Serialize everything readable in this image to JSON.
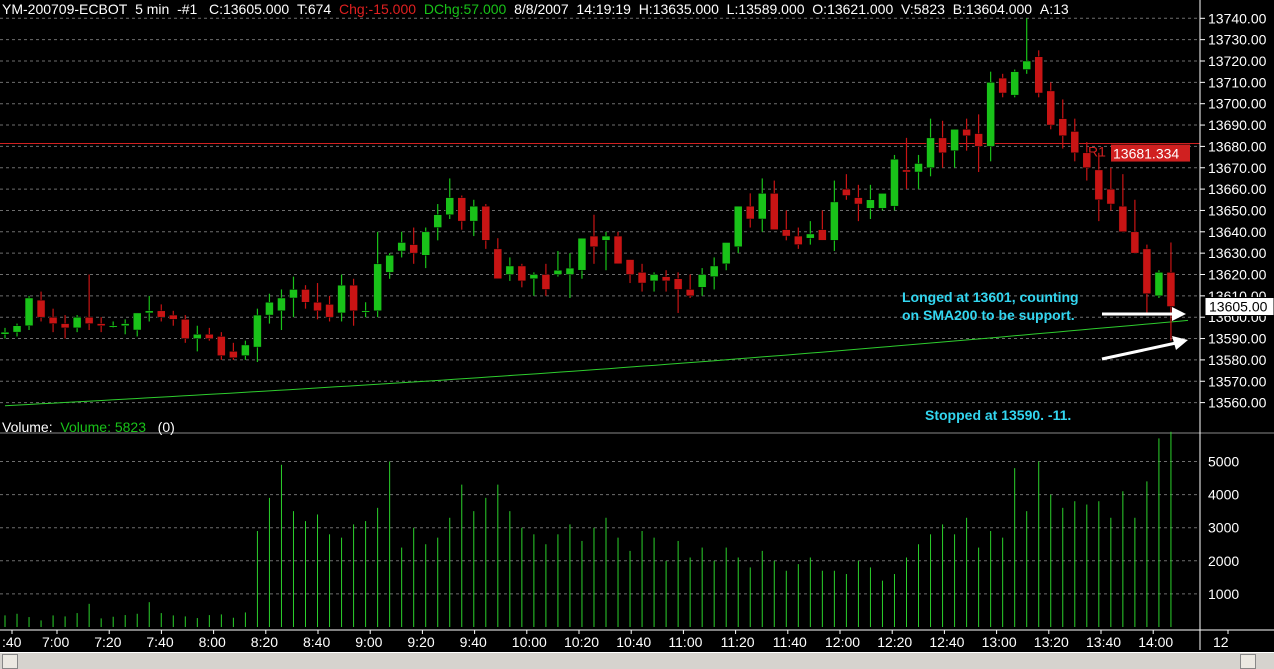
{
  "header": {
    "symbol": "YM-200709-ECBOT",
    "interval": "5 min",
    "chart_id": "-#1",
    "close": "C:13605.000",
    "tick": "T:674",
    "chg": "Chg:-15.000",
    "dchg": "DChg:57.000",
    "date": "8/8/2007",
    "time": "14:19:19",
    "high": "H:13635.000",
    "low": "L:13589.000",
    "open": "O:13621.000",
    "volume": "V:5823",
    "bid": "B:13604.000",
    "ask": "A:13"
  },
  "volume_header": {
    "label": "Volume:",
    "indicator": "Volume: 5823",
    "zero": "(0)"
  },
  "annotations": {
    "entry_line1": "Longed at 13601, counting",
    "entry_line2": "on SMA200 to be support.",
    "stop": "Stopped at 13590.  -11."
  },
  "price_axis": {
    "labels": [
      "13740.00",
      "13730.00",
      "13720.00",
      "13710.00",
      "13700.00",
      "13690.00",
      "13680.00",
      "13670.00",
      "13660.00",
      "13650.00",
      "13640.00",
      "13630.00",
      "13620.00",
      "13610.00",
      "13600.00",
      "13590.00",
      "13580.00",
      "13570.00",
      "13560.00"
    ],
    "last_price": "13605.00"
  },
  "pivot": {
    "label": "R1",
    "value": "13681.334"
  },
  "volume_axis": {
    "labels": [
      "5000",
      "4000",
      "3000",
      "2000",
      "1000"
    ]
  },
  "time_axis": {
    "labels": [
      ":40",
      "7:00",
      "7:20",
      "7:40",
      "8:00",
      "8:20",
      "8:40",
      "9:00",
      "9:20",
      "9:40",
      "10:00",
      "10:20",
      "10:40",
      "11:00",
      "11:20",
      "11:40",
      "12:00",
      "12:20",
      "12:40",
      "13:00",
      "13:20",
      "13:40",
      "14:00",
      "12"
    ]
  },
  "colors": {
    "up": "#19c219",
    "down": "#c81414",
    "sma": "#2ecc2e",
    "volume": "#2bd12b",
    "pivot": "#d02020",
    "annotation": "#33d6f0",
    "grid": "#6e6e6e"
  },
  "chart_data": {
    "type": "candlestick",
    "y_range": [
      13555,
      13742
    ],
    "volume_range": [
      0,
      5900
    ],
    "candles": [
      {
        "o": 13592,
        "h": 13595,
        "l": 13590,
        "c": 13593
      },
      {
        "o": 13593,
        "h": 13597,
        "l": 13591,
        "c": 13596
      },
      {
        "o": 13596,
        "h": 13610,
        "l": 13594,
        "c": 13609
      },
      {
        "o": 13608,
        "h": 13612,
        "l": 13598,
        "c": 13600
      },
      {
        "o": 13600,
        "h": 13604,
        "l": 13593,
        "c": 13597
      },
      {
        "o": 13597,
        "h": 13601,
        "l": 13590,
        "c": 13595
      },
      {
        "o": 13595,
        "h": 13601,
        "l": 13593,
        "c": 13600
      },
      {
        "o": 13600,
        "h": 13620,
        "l": 13594,
        "c": 13597
      },
      {
        "o": 13597,
        "h": 13600,
        "l": 13593,
        "c": 13596
      },
      {
        "o": 13596,
        "h": 13598,
        "l": 13595,
        "c": 13596
      },
      {
        "o": 13596,
        "h": 13599,
        "l": 13592,
        "c": 13597
      },
      {
        "o": 13594,
        "h": 13602,
        "l": 13591,
        "c": 13602
      },
      {
        "o": 13602,
        "h": 13610,
        "l": 13598,
        "c": 13603
      },
      {
        "o": 13603,
        "h": 13606,
        "l": 13598,
        "c": 13600
      },
      {
        "o": 13601,
        "h": 13603,
        "l": 13596,
        "c": 13599
      },
      {
        "o": 13599,
        "h": 13601,
        "l": 13588,
        "c": 13590
      },
      {
        "o": 13590,
        "h": 13596,
        "l": 13584,
        "c": 13592
      },
      {
        "o": 13592,
        "h": 13595,
        "l": 13589,
        "c": 13590
      },
      {
        "o": 13591,
        "h": 13593,
        "l": 13580,
        "c": 13582
      },
      {
        "o": 13584,
        "h": 13588,
        "l": 13580,
        "c": 13581
      },
      {
        "o": 13582,
        "h": 13589,
        "l": 13580,
        "c": 13587
      },
      {
        "o": 13586,
        "h": 13604,
        "l": 13579,
        "c": 13601
      },
      {
        "o": 13601,
        "h": 13611,
        "l": 13597,
        "c": 13607
      },
      {
        "o": 13603,
        "h": 13613,
        "l": 13594,
        "c": 13609
      },
      {
        "o": 13609,
        "h": 13619,
        "l": 13600,
        "c": 13613
      },
      {
        "o": 13613,
        "h": 13615,
        "l": 13604,
        "c": 13607
      },
      {
        "o": 13607,
        "h": 13616,
        "l": 13599,
        "c": 13603
      },
      {
        "o": 13606,
        "h": 13610,
        "l": 13598,
        "c": 13600
      },
      {
        "o": 13602,
        "h": 13620,
        "l": 13598,
        "c": 13615
      },
      {
        "o": 13615,
        "h": 13618,
        "l": 13596,
        "c": 13603
      },
      {
        "o": 13603,
        "h": 13607,
        "l": 13600,
        "c": 13603
      },
      {
        "o": 13603,
        "h": 13640,
        "l": 13600,
        "c": 13625
      },
      {
        "o": 13621,
        "h": 13630,
        "l": 13618,
        "c": 13629
      },
      {
        "o": 13631,
        "h": 13640,
        "l": 13628,
        "c": 13635
      },
      {
        "o": 13634,
        "h": 13642,
        "l": 13625,
        "c": 13630
      },
      {
        "o": 13629,
        "h": 13642,
        "l": 13623,
        "c": 13640
      },
      {
        "o": 13642,
        "h": 13653,
        "l": 13636,
        "c": 13648
      },
      {
        "o": 13648,
        "h": 13665,
        "l": 13646,
        "c": 13656
      },
      {
        "o": 13656,
        "h": 13657,
        "l": 13641,
        "c": 13645
      },
      {
        "o": 13645,
        "h": 13655,
        "l": 13638,
        "c": 13652
      },
      {
        "o": 13652,
        "h": 13653,
        "l": 13632,
        "c": 13636
      },
      {
        "o": 13632,
        "h": 13637,
        "l": 13618,
        "c": 13618
      },
      {
        "o": 13620,
        "h": 13628,
        "l": 13617,
        "c": 13624
      },
      {
        "o": 13624,
        "h": 13625,
        "l": 13614,
        "c": 13617
      },
      {
        "o": 13618,
        "h": 13621,
        "l": 13610,
        "c": 13620
      },
      {
        "o": 13620,
        "h": 13625,
        "l": 13610,
        "c": 13613
      },
      {
        "o": 13620,
        "h": 13631,
        "l": 13619,
        "c": 13622
      },
      {
        "o": 13620,
        "h": 13630,
        "l": 13609,
        "c": 13623
      },
      {
        "o": 13622,
        "h": 13635,
        "l": 13618,
        "c": 13637
      },
      {
        "o": 13638,
        "h": 13648,
        "l": 13625,
        "c": 13633
      },
      {
        "o": 13636,
        "h": 13640,
        "l": 13622,
        "c": 13638
      },
      {
        "o": 13638,
        "h": 13640,
        "l": 13625,
        "c": 13625
      },
      {
        "o": 13627,
        "h": 13625,
        "l": 13616,
        "c": 13620
      },
      {
        "o": 13621,
        "h": 13625,
        "l": 13612,
        "c": 13616
      },
      {
        "o": 13617,
        "h": 13621,
        "l": 13612,
        "c": 13620
      },
      {
        "o": 13619,
        "h": 13622,
        "l": 13612,
        "c": 13617
      },
      {
        "o": 13618,
        "h": 13621,
        "l": 13602,
        "c": 13613
      },
      {
        "o": 13613,
        "h": 13620,
        "l": 13609,
        "c": 13610
      },
      {
        "o": 13614,
        "h": 13623,
        "l": 13610,
        "c": 13620
      },
      {
        "o": 13619,
        "h": 13628,
        "l": 13613,
        "c": 13624
      },
      {
        "o": 13625,
        "h": 13633,
        "l": 13622,
        "c": 13635
      },
      {
        "o": 13633,
        "h": 13652,
        "l": 13630,
        "c": 13652
      },
      {
        "o": 13652,
        "h": 13658,
        "l": 13642,
        "c": 13646
      },
      {
        "o": 13646,
        "h": 13665,
        "l": 13640,
        "c": 13658
      },
      {
        "o": 13658,
        "h": 13664,
        "l": 13643,
        "c": 13641
      },
      {
        "o": 13641,
        "h": 13650,
        "l": 13636,
        "c": 13638
      },
      {
        "o": 13638,
        "h": 13642,
        "l": 13632,
        "c": 13634
      },
      {
        "o": 13637,
        "h": 13645,
        "l": 13634,
        "c": 13639
      },
      {
        "o": 13641,
        "h": 13650,
        "l": 13636,
        "c": 13636
      },
      {
        "o": 13636,
        "h": 13664,
        "l": 13631,
        "c": 13654
      },
      {
        "o": 13660,
        "h": 13667,
        "l": 13655,
        "c": 13657
      },
      {
        "o": 13656,
        "h": 13662,
        "l": 13645,
        "c": 13653
      },
      {
        "o": 13651,
        "h": 13662,
        "l": 13646,
        "c": 13655
      },
      {
        "o": 13651,
        "h": 13658,
        "l": 13650,
        "c": 13658
      },
      {
        "o": 13652,
        "h": 13676,
        "l": 13650,
        "c": 13674
      },
      {
        "o": 13669,
        "h": 13684,
        "l": 13660,
        "c": 13668
      },
      {
        "o": 13668,
        "h": 13676,
        "l": 13660,
        "c": 13672
      },
      {
        "o": 13670,
        "h": 13693,
        "l": 13666,
        "c": 13684
      },
      {
        "o": 13684,
        "h": 13692,
        "l": 13670,
        "c": 13677
      },
      {
        "o": 13678,
        "h": 13686,
        "l": 13670,
        "c": 13688
      },
      {
        "o": 13688,
        "h": 13693,
        "l": 13678,
        "c": 13685
      },
      {
        "o": 13686,
        "h": 13695,
        "l": 13668,
        "c": 13680
      },
      {
        "o": 13680,
        "h": 13715,
        "l": 13673,
        "c": 13710
      },
      {
        "o": 13712,
        "h": 13714,
        "l": 13703,
        "c": 13705
      },
      {
        "o": 13704,
        "h": 13716,
        "l": 13703,
        "c": 13715
      },
      {
        "o": 13716,
        "h": 13740,
        "l": 13714,
        "c": 13720
      },
      {
        "o": 13722,
        "h": 13725,
        "l": 13703,
        "c": 13705
      },
      {
        "o": 13706,
        "h": 13710,
        "l": 13688,
        "c": 13690
      },
      {
        "o": 13693,
        "h": 13702,
        "l": 13679,
        "c": 13685
      },
      {
        "o": 13687,
        "h": 13693,
        "l": 13673,
        "c": 13677
      },
      {
        "o": 13677,
        "h": 13682,
        "l": 13664,
        "c": 13670
      },
      {
        "o": 13669,
        "h": 13677,
        "l": 13645,
        "c": 13655
      },
      {
        "o": 13660,
        "h": 13670,
        "l": 13650,
        "c": 13653
      },
      {
        "o": 13652,
        "h": 13667,
        "l": 13640,
        "c": 13640
      },
      {
        "o": 13640,
        "h": 13655,
        "l": 13630,
        "c": 13630
      },
      {
        "o": 13632,
        "h": 13634,
        "l": 13602,
        "c": 13611
      },
      {
        "o": 13610,
        "h": 13622,
        "l": 13609,
        "c": 13621
      },
      {
        "o": 13621,
        "h": 13635,
        "l": 13589,
        "c": 13605
      }
    ],
    "volume": [
      350,
      400,
      300,
      200,
      350,
      320,
      420,
      700,
      260,
      310,
      360,
      400,
      750,
      420,
      350,
      320,
      270,
      360,
      380,
      280,
      440,
      2900,
      3900,
      4900,
      3500,
      3200,
      3400,
      2800,
      2700,
      3100,
      3200,
      3600,
      5000,
      2400,
      3000,
      2500,
      2700,
      3300,
      4300,
      3500,
      3900,
      4300,
      3500,
      3000,
      2800,
      2500,
      2800,
      3100,
      2600,
      3000,
      3300,
      2700,
      2300,
      2900,
      2700,
      2000,
      2600,
      2100,
      2400,
      2000,
      2400,
      2100,
      1800,
      2300,
      2000,
      1700,
      1900,
      2100,
      1700,
      1700,
      1600,
      2000,
      1800,
      1400,
      1600,
      2100,
      2500,
      2800,
      3100,
      2800,
      3300,
      2400,
      2900,
      2700,
      4800,
      3500,
      5000,
      4000,
      3600,
      3800,
      3700,
      3800,
      3300,
      4100,
      3300,
      4400,
      5700,
      5900
    ]
  }
}
